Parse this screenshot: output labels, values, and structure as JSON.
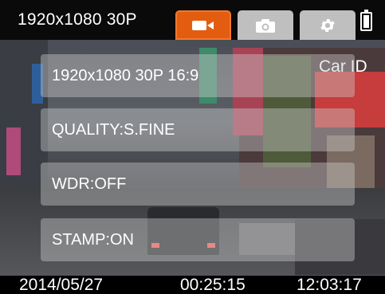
{
  "top_bar": {
    "resolution_status": "1920x1080 30P",
    "modes": [
      {
        "name": "video",
        "icon": "video-camera-icon",
        "active": true
      },
      {
        "name": "photo",
        "icon": "camera-icon",
        "active": false
      },
      {
        "name": "setup",
        "icon": "gear-icon",
        "active": false
      }
    ],
    "battery_icon": "battery-icon",
    "active_color": "#e35d10"
  },
  "overlay": {
    "car_id_label": "Car ID"
  },
  "settings": [
    {
      "label": "1920x1080 30P 16:9"
    },
    {
      "label": "QUALITY:S.FINE"
    },
    {
      "label": "WDR:OFF"
    },
    {
      "label": "STAMP:ON"
    }
  ],
  "bottom_bar": {
    "date": "2014/05/27",
    "elapsed": "00:25:15",
    "clock": "12:03:17"
  }
}
